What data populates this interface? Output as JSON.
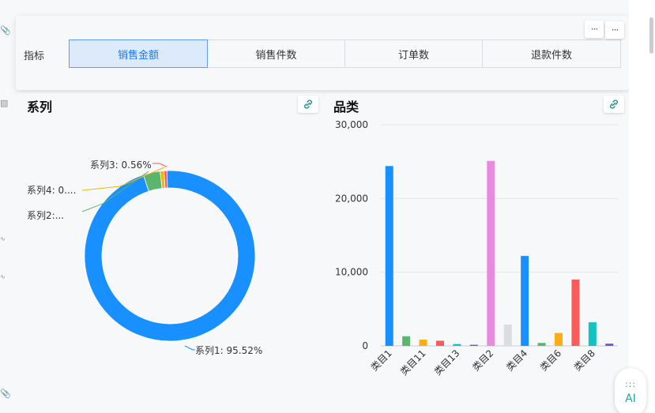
{
  "filter": {
    "label": "指标",
    "options": [
      "销售金额",
      "销售件数",
      "订单数",
      "退款件数"
    ],
    "selected_index": 0,
    "more_label": "···"
  },
  "series_card": {
    "title": "系列"
  },
  "category_card": {
    "title": "品类"
  },
  "ai_button": {
    "dots": ":::",
    "label": "AI"
  },
  "colors": {
    "accent": "#1677ff",
    "selected_bg": "#dceafc",
    "teal": "#1aa7a7"
  },
  "chart_data": [
    {
      "type": "pie",
      "title": "系列",
      "labels": [
        "系列1",
        "系列2",
        "系列3",
        "系列4"
      ],
      "values": [
        95.52,
        3.2,
        0.56,
        0.72
      ],
      "label_text": [
        "系列1: 95.52%",
        "系列2:...",
        "系列3: 0.56%",
        "系列4: 0...."
      ],
      "colors": [
        "#1890ff",
        "#5ab56e",
        "#fa5c5c",
        "#f2b705"
      ],
      "donut": true
    },
    {
      "type": "bar",
      "title": "品类",
      "categories": [
        "类目1",
        "",
        "类目11",
        "",
        "类目13",
        "",
        "类目2",
        "",
        "类目4",
        "",
        "类目6",
        "",
        "类目8",
        ""
      ],
      "values": [
        24400,
        1300,
        850,
        700,
        250,
        150,
        25100,
        2900,
        12200,
        400,
        1750,
        9000,
        3200,
        300
      ],
      "colors": [
        "#1890ff",
        "#5ab56e",
        "#faad14",
        "#fa5c5c",
        "#13c2c2",
        "#7c4ddb",
        "#e88be0",
        "#dcdde2",
        "#1890ff",
        "#5ab56e",
        "#faad14",
        "#fa5c5c",
        "#13c2c2",
        "#7c4ddb"
      ],
      "ylim": [
        0,
        30000
      ],
      "yticks": [
        0,
        10000,
        20000,
        30000
      ],
      "ytick_labels": [
        "0",
        "10,000",
        "20,000",
        "30,000"
      ],
      "grid": true
    }
  ]
}
